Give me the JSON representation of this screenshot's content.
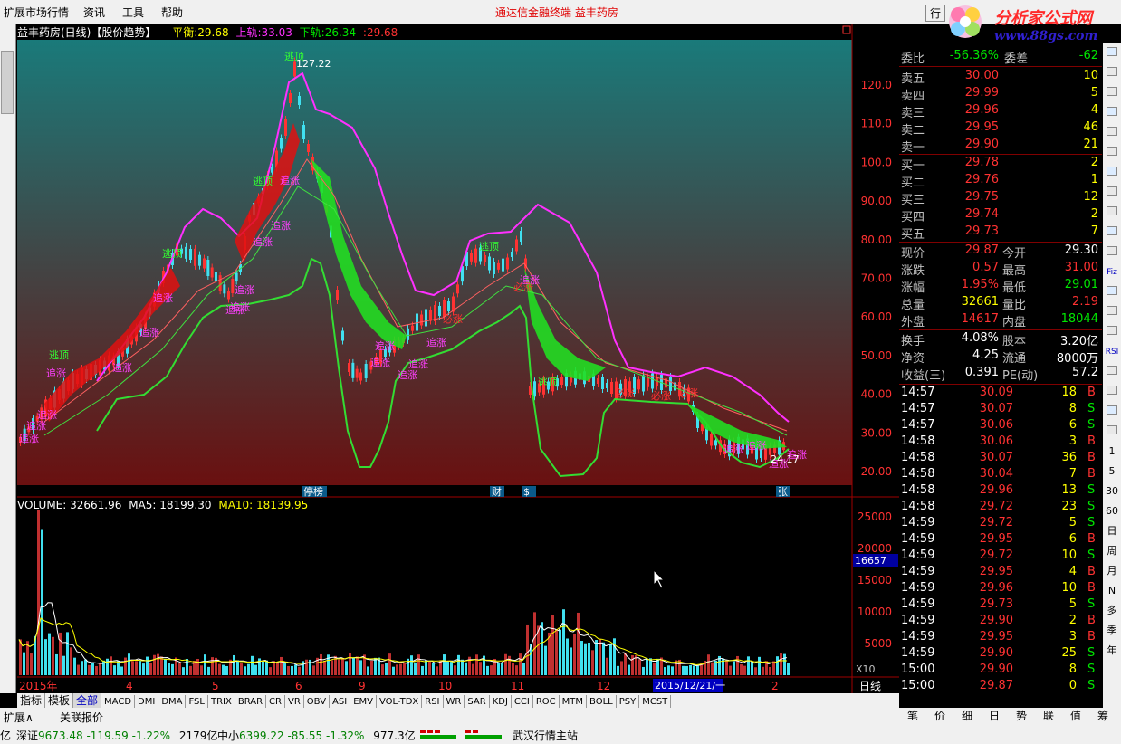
{
  "menu": {
    "items": [
      "扩展市场行情",
      "资讯",
      "工具",
      "帮助"
    ],
    "center": "通达信金融终端  益丰药房",
    "right": "行"
  },
  "watermark": {
    "text": "分析家公式网",
    "url": "www.88gs.com"
  },
  "kline": {
    "title": "益丰药房(日线)【股价趋势】",
    "ph_label": "平衡:",
    "ph": "29.68",
    "up_label": "上轨:",
    "up": "33.03",
    "dn_label": "下轨:",
    "dn": "26.34",
    "last": "29.68",
    "peak": "127.22",
    "low": "24.17",
    "yticks": [
      "120.0",
      "110.0",
      "100.0",
      "90.00",
      "80.00",
      "70.00",
      "60.00",
      "50.00",
      "40.00",
      "30.00",
      "20.00"
    ],
    "labels": {
      "zhuizhang": "追涨",
      "taoding": "逃顶",
      "bizhang": "必涨"
    },
    "bottom": [
      "停榜",
      "财",
      "$",
      "张"
    ]
  },
  "volume": {
    "label": "VOLUME: 32661.96",
    "ma5": "MA5: 18199.30",
    "ma10": "MA10: 18139.95",
    "yticks": [
      "25000",
      "20000",
      "15000",
      "10000",
      "5000"
    ],
    "mark": "16657",
    "unit": "X10"
  },
  "xaxis": {
    "labels": [
      "2015年",
      "4",
      "5",
      "6",
      "9",
      "10",
      "11",
      "12",
      "2",
      "2015/12/21/一"
    ],
    "period": "日线"
  },
  "tabs": [
    "指标",
    "模板",
    "全部",
    "MACD",
    "DMI",
    "DMA",
    "FSL",
    "TRIX",
    "BRAR",
    "CR",
    "VR",
    "OBV",
    "ASI",
    "EMV",
    "VOL-TDX",
    "RSI",
    "WR",
    "SAR",
    "KDJ",
    "CCI",
    "ROC",
    "MTM",
    "BOLL",
    "PSY",
    "MCST"
  ],
  "bottom_row": [
    "扩展∧",
    "关联报价"
  ],
  "panel": {
    "wb": {
      "l1": "委比",
      "v1": "-56.36%",
      "l2": "委差",
      "v2": "-62"
    },
    "sell": [
      {
        "l": "卖五",
        "p": "30.00",
        "v": "10"
      },
      {
        "l": "卖四",
        "p": "29.99",
        "v": "5"
      },
      {
        "l": "卖三",
        "p": "29.96",
        "v": "4"
      },
      {
        "l": "卖二",
        "p": "29.95",
        "v": "46"
      },
      {
        "l": "卖一",
        "p": "29.90",
        "v": "21"
      }
    ],
    "buy": [
      {
        "l": "买一",
        "p": "29.78",
        "v": "2"
      },
      {
        "l": "买二",
        "p": "29.76",
        "v": "1"
      },
      {
        "l": "买三",
        "p": "29.75",
        "v": "12"
      },
      {
        "l": "买四",
        "p": "29.74",
        "v": "2"
      },
      {
        "l": "买五",
        "p": "29.73",
        "v": "7"
      }
    ],
    "quote": [
      {
        "l1": "现价",
        "v1": "29.87",
        "c1": "red",
        "l2": "今开",
        "v2": "29.30",
        "c2": "wht"
      },
      {
        "l1": "涨跌",
        "v1": "0.57",
        "c1": "red",
        "l2": "最高",
        "v2": "31.00",
        "c2": "red"
      },
      {
        "l1": "涨幅",
        "v1": "1.95%",
        "c1": "red",
        "l2": "最低",
        "v2": "29.01",
        "c2": "grn"
      },
      {
        "l1": "总量",
        "v1": "32661",
        "c1": "yel",
        "l2": "量比",
        "v2": "2.19",
        "c2": "red"
      },
      {
        "l1": "外盘",
        "v1": "14617",
        "c1": "red",
        "l2": "内盘",
        "v2": "18044",
        "c2": "grn"
      }
    ],
    "quote2": [
      {
        "l1": "换手",
        "v1": "4.08%",
        "l2": "股本",
        "v2": "3.20亿"
      },
      {
        "l1": "净资",
        "v1": "4.25",
        "l2": "流通",
        "v2": "8000万"
      },
      {
        "l1": "收益(三)",
        "v1": "0.391",
        "l2": "PE(动)",
        "v2": "57.2"
      }
    ],
    "ticks": [
      {
        "t": "14:57",
        "p": "30.09",
        "v": "18",
        "s": "B"
      },
      {
        "t": "14:57",
        "p": "30.07",
        "v": "8",
        "s": "S"
      },
      {
        "t": "14:57",
        "p": "30.06",
        "v": "6",
        "s": "S"
      },
      {
        "t": "14:58",
        "p": "30.06",
        "v": "3",
        "s": "B"
      },
      {
        "t": "14:58",
        "p": "30.07",
        "v": "36",
        "s": "B"
      },
      {
        "t": "14:58",
        "p": "30.04",
        "v": "7",
        "s": "B"
      },
      {
        "t": "14:58",
        "p": "29.96",
        "v": "13",
        "s": "S"
      },
      {
        "t": "14:58",
        "p": "29.72",
        "v": "23",
        "s": "S"
      },
      {
        "t": "14:59",
        "p": "29.72",
        "v": "5",
        "s": "S"
      },
      {
        "t": "14:59",
        "p": "29.95",
        "v": "6",
        "s": "B"
      },
      {
        "t": "14:59",
        "p": "29.72",
        "v": "10",
        "s": "S"
      },
      {
        "t": "14:59",
        "p": "29.95",
        "v": "4",
        "s": "B"
      },
      {
        "t": "14:59",
        "p": "29.96",
        "v": "10",
        "s": "B"
      },
      {
        "t": "14:59",
        "p": "29.73",
        "v": "5",
        "s": "S"
      },
      {
        "t": "14:59",
        "p": "29.90",
        "v": "2",
        "s": "B"
      },
      {
        "t": "14:59",
        "p": "29.95",
        "v": "3",
        "s": "B"
      },
      {
        "t": "14:59",
        "p": "29.90",
        "v": "25",
        "s": "S"
      },
      {
        "t": "15:00",
        "p": "29.90",
        "v": "8",
        "s": "S"
      },
      {
        "t": "15:00",
        "p": "29.87",
        "v": "0",
        "s": "S"
      }
    ],
    "tabs": [
      "笔",
      "价",
      "细",
      "日",
      "势",
      "联",
      "值",
      "筹"
    ]
  },
  "right_tools": [
    "1",
    "5",
    "30",
    "60",
    "日",
    "周",
    "月",
    "N",
    "多",
    "季",
    "年"
  ],
  "right_tool_icons": [
    "Fiz",
    "RSI"
  ],
  "status": {
    "sz_label": "深证",
    "sz": "9673.48",
    "sz_chg": "-119.59",
    "sz_pct": "-1.22%",
    "sz_amt": "2179亿",
    "zx_label": "中小",
    "zx": "6399.22",
    "zx_chg": "-85.55",
    "zx_pct": "-1.32%",
    "zx_amt": "977.3亿",
    "station": "武汉行情主站",
    "lead": "亿"
  },
  "colors": {
    "up": "#ff3232",
    "down": "#00e600",
    "upper": "#ff30ff",
    "lower": "#33dd33"
  }
}
